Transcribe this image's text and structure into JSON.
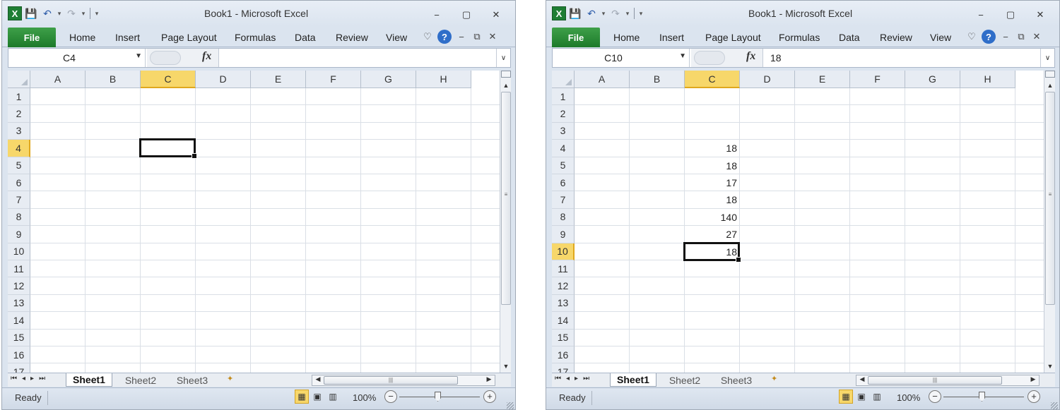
{
  "windows": [
    {
      "title": "Book1  -  Microsoft Excel",
      "ribbon_tabs": [
        "File",
        "Home",
        "Insert",
        "Page Layout",
        "Formulas",
        "Data",
        "Review",
        "View"
      ],
      "name_box": "C4",
      "formula_value": "",
      "fx_label": "fx",
      "columns": [
        "A",
        "B",
        "C",
        "D",
        "E",
        "F",
        "G",
        "H"
      ],
      "selected_column": "C",
      "rows": [
        "1",
        "2",
        "3",
        "4",
        "5",
        "6",
        "7",
        "8",
        "9",
        "10",
        "11",
        "12",
        "13",
        "14",
        "15",
        "16",
        "17"
      ],
      "selected_row": "4",
      "cells": [],
      "sheet_tabs": [
        "Sheet1",
        "Sheet2",
        "Sheet3"
      ],
      "active_sheet": "Sheet1",
      "status": "Ready",
      "zoom": "100%"
    },
    {
      "title": "Book1  -  Microsoft Excel",
      "ribbon_tabs": [
        "File",
        "Home",
        "Insert",
        "Page Layout",
        "Formulas",
        "Data",
        "Review",
        "View"
      ],
      "name_box": "C10",
      "formula_value": "18",
      "fx_label": "fx",
      "columns": [
        "A",
        "B",
        "C",
        "D",
        "E",
        "F",
        "G",
        "H"
      ],
      "selected_column": "C",
      "rows": [
        "1",
        "2",
        "3",
        "4",
        "5",
        "6",
        "7",
        "8",
        "9",
        "10",
        "11",
        "12",
        "13",
        "14",
        "15",
        "16",
        "17"
      ],
      "selected_row": "10",
      "cells": [
        {
          "ref": "C4",
          "value": "18"
        },
        {
          "ref": "C5",
          "value": "18"
        },
        {
          "ref": "C6",
          "value": "17"
        },
        {
          "ref": "C7",
          "value": "18"
        },
        {
          "ref": "C8",
          "value": "140"
        },
        {
          "ref": "C9",
          "value": "27"
        },
        {
          "ref": "C10",
          "value": "18"
        }
      ],
      "sheet_tabs": [
        "Sheet1",
        "Sheet2",
        "Sheet3"
      ],
      "active_sheet": "Sheet1",
      "status": "Ready",
      "zoom": "100%"
    }
  ],
  "icons": {
    "app": "excel-icon",
    "save": "save-icon",
    "undo": "undo-icon",
    "redo": "redo-icon",
    "help": "help-icon"
  },
  "colors": {
    "file_tab": "#1d7a2a",
    "selected_header": "#f7d76a",
    "active_view": "#f7d76a"
  }
}
